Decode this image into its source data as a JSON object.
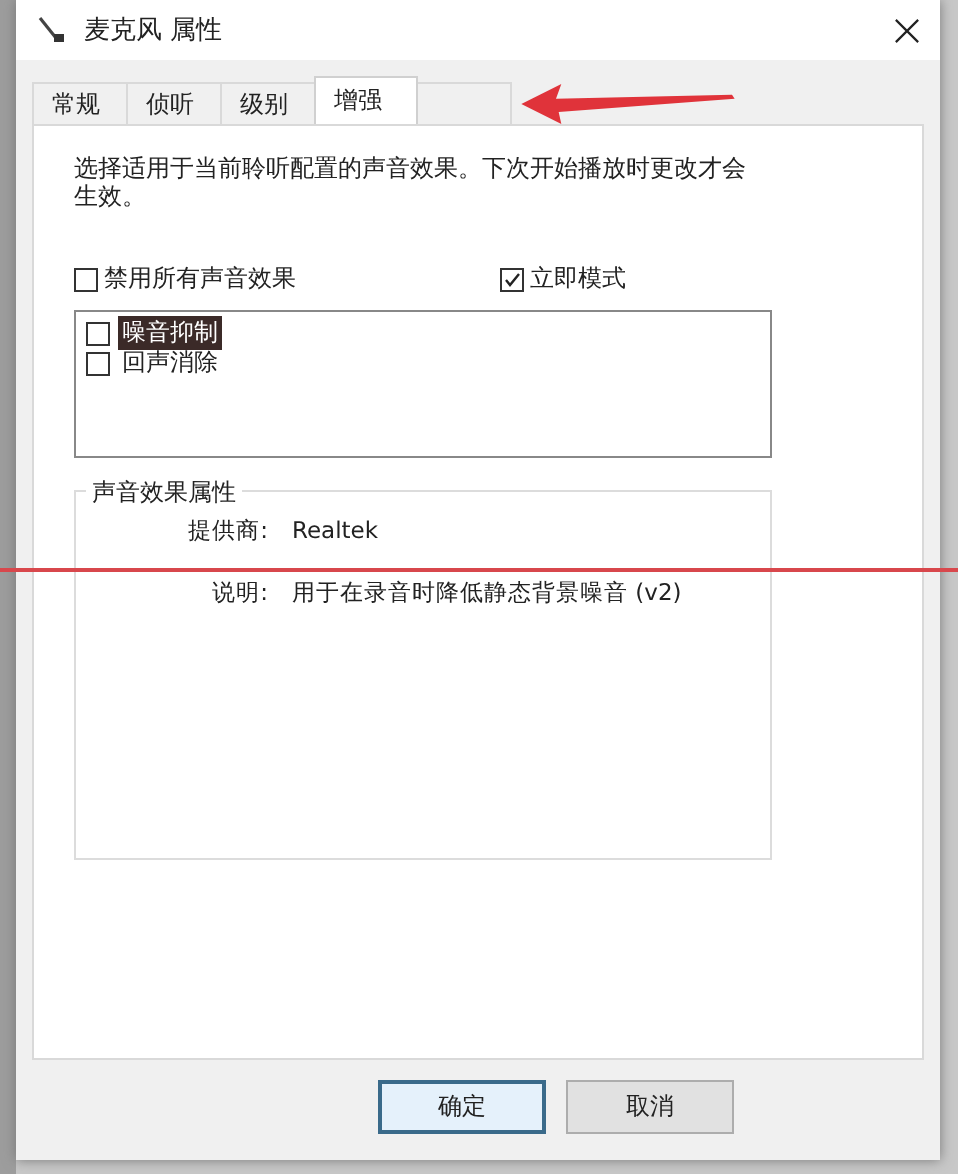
{
  "window": {
    "title": "麦克风 属性"
  },
  "tabs": [
    {
      "label": "常规",
      "selected": false
    },
    {
      "label": "侦听",
      "selected": false
    },
    {
      "label": "级别",
      "selected": false
    },
    {
      "label": "增强",
      "selected": true
    }
  ],
  "description": "选择适用于当前聆听配置的声音效果。下次开始播放时更改才会生效。",
  "disable_all": {
    "label": "禁用所有声音效果",
    "checked": false
  },
  "immediate_mode": {
    "label": "立即模式",
    "checked": true
  },
  "effects": [
    {
      "label": "噪音抑制",
      "checked": false,
      "selected": true
    },
    {
      "label": "回声消除",
      "checked": false,
      "selected": false
    }
  ],
  "properties": {
    "title": "声音效果属性",
    "rows": [
      {
        "label": "提供商:",
        "value": "Realtek"
      },
      {
        "label": "说明:",
        "value": "用于在录音时降低静态背景噪音 (v2)"
      }
    ]
  },
  "buttons": [
    {
      "label": "确定",
      "default": true
    },
    {
      "label": "取消",
      "default": false
    }
  ]
}
